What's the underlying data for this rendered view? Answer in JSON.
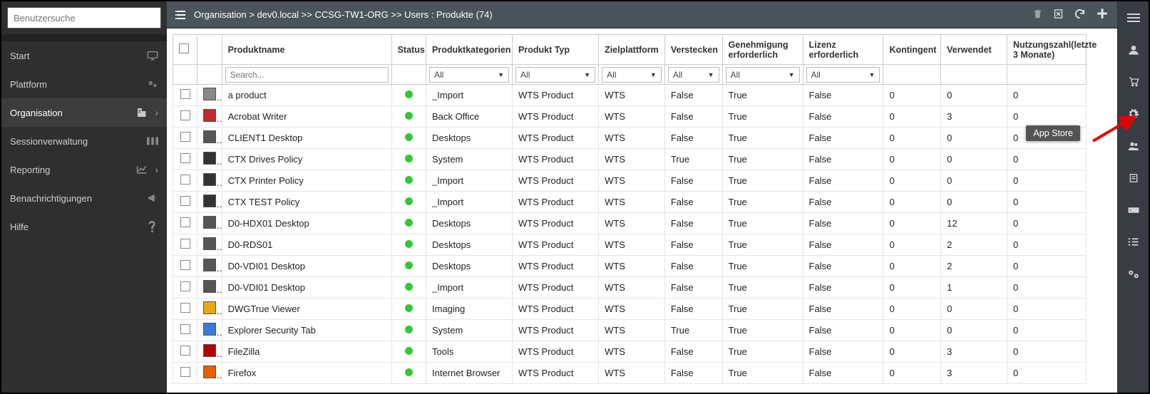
{
  "search_placeholder": "Benutzersuche",
  "sidebar": [
    {
      "label": "Start",
      "icon": "monitor",
      "chevron": false,
      "active": false
    },
    {
      "label": "Plattform",
      "icon": "gears",
      "chevron": false,
      "active": false
    },
    {
      "label": "Organisation",
      "icon": "building",
      "chevron": true,
      "active": true
    },
    {
      "label": "Sessionverwaltung",
      "icon": "grid",
      "chevron": false,
      "active": false
    },
    {
      "label": "Reporting",
      "icon": "chart",
      "chevron": true,
      "active": false
    },
    {
      "label": "Benachrichtigungen",
      "icon": "megaphone",
      "chevron": false,
      "active": false
    },
    {
      "label": "Hilfe",
      "icon": "question",
      "chevron": false,
      "active": false
    }
  ],
  "breadcrumb": "Organisation > dev0.local >> CCSG-TW1-ORG >> Users : Produkte (74)",
  "columns": {
    "name": "Produktname",
    "status": "Status",
    "category": "Produktkategorien",
    "type": "Produkt Typ",
    "platform": "Zielplattform",
    "hidden": "Verstecken",
    "approval": "Genehmigung erforderlich",
    "license": "Lizenz erforderlich",
    "quota": "Kontingent",
    "used": "Verwendet",
    "usage": "Nutzungszahl(letzte 3 Monate)"
  },
  "filter": {
    "search_placeholder": "Search...",
    "all": "All"
  },
  "tooltip": "App Store",
  "rows": [
    {
      "name": "a product",
      "cat": "_Import",
      "type": "WTS Product",
      "plat": "WTS",
      "hide": "False",
      "appr": "True",
      "lic": "False",
      "quota": "0",
      "used": "0",
      "usage": "0",
      "icon": "#888"
    },
    {
      "name": "Acrobat Writer",
      "cat": "Back Office",
      "type": "WTS Product",
      "plat": "WTS",
      "hide": "False",
      "appr": "True",
      "lic": "False",
      "quota": "0",
      "used": "3",
      "usage": "0",
      "icon": "#c1272d"
    },
    {
      "name": "CLIENT1 Desktop",
      "cat": "Desktops",
      "type": "WTS Product",
      "plat": "WTS",
      "hide": "False",
      "appr": "True",
      "lic": "False",
      "quota": "0",
      "used": "0",
      "usage": "0",
      "icon": "#555"
    },
    {
      "name": "CTX Drives Policy",
      "cat": "System",
      "type": "WTS Product",
      "plat": "WTS",
      "hide": "True",
      "appr": "True",
      "lic": "False",
      "quota": "0",
      "used": "0",
      "usage": "0",
      "icon": "#333"
    },
    {
      "name": "CTX Printer Policy",
      "cat": "_Import",
      "type": "WTS Product",
      "plat": "WTS",
      "hide": "False",
      "appr": "True",
      "lic": "False",
      "quota": "0",
      "used": "0",
      "usage": "0",
      "icon": "#333"
    },
    {
      "name": "CTX TEST Policy",
      "cat": "_Import",
      "type": "WTS Product",
      "plat": "WTS",
      "hide": "False",
      "appr": "True",
      "lic": "False",
      "quota": "0",
      "used": "0",
      "usage": "0",
      "icon": "#333"
    },
    {
      "name": "D0-HDX01 Desktop",
      "cat": "Desktops",
      "type": "WTS Product",
      "plat": "WTS",
      "hide": "False",
      "appr": "True",
      "lic": "False",
      "quota": "0",
      "used": "12",
      "usage": "0",
      "icon": "#555"
    },
    {
      "name": "D0-RDS01",
      "cat": "Desktops",
      "type": "WTS Product",
      "plat": "WTS",
      "hide": "False",
      "appr": "True",
      "lic": "False",
      "quota": "0",
      "used": "2",
      "usage": "0",
      "icon": "#555"
    },
    {
      "name": "D0-VDI01 Desktop",
      "cat": "Desktops",
      "type": "WTS Product",
      "plat": "WTS",
      "hide": "False",
      "appr": "True",
      "lic": "False",
      "quota": "0",
      "used": "2",
      "usage": "0",
      "icon": "#555"
    },
    {
      "name": "D0-VDI01 Desktop",
      "cat": "_Import",
      "type": "WTS Product",
      "plat": "WTS",
      "hide": "False",
      "appr": "True",
      "lic": "False",
      "quota": "0",
      "used": "1",
      "usage": "0",
      "icon": "#555"
    },
    {
      "name": "DWGTrue Viewer",
      "cat": "Imaging",
      "type": "WTS Product",
      "plat": "WTS",
      "hide": "False",
      "appr": "True",
      "lic": "False",
      "quota": "0",
      "used": "0",
      "usage": "0",
      "icon": "#e6a817"
    },
    {
      "name": "Explorer Security Tab",
      "cat": "System",
      "type": "WTS Product",
      "plat": "WTS",
      "hide": "True",
      "appr": "True",
      "lic": "False",
      "quota": "0",
      "used": "0",
      "usage": "0",
      "icon": "#3a7bd5"
    },
    {
      "name": "FileZilla",
      "cat": "Tools",
      "type": "WTS Product",
      "plat": "WTS",
      "hide": "False",
      "appr": "True",
      "lic": "False",
      "quota": "0",
      "used": "3",
      "usage": "0",
      "icon": "#b30000"
    },
    {
      "name": "Firefox",
      "cat": "Internet Browser",
      "type": "WTS Product",
      "plat": "WTS",
      "hide": "False",
      "appr": "True",
      "lic": "False",
      "quota": "0",
      "used": "3",
      "usage": "0",
      "icon": "#e66000"
    }
  ]
}
